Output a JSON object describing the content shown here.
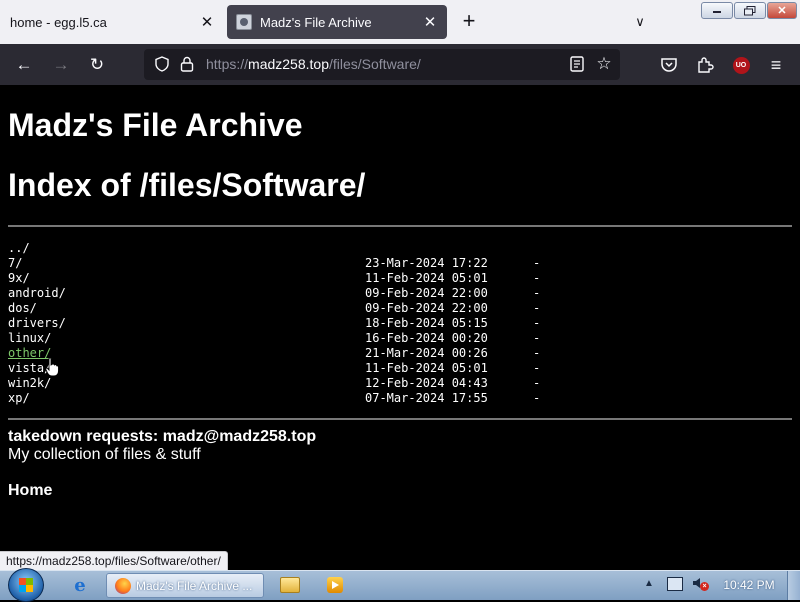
{
  "browser": {
    "tabs": [
      {
        "title": "home - egg.l5.ca",
        "active": false
      },
      {
        "title": "Madz's File Archive",
        "active": true
      }
    ],
    "url_prefix": "https://",
    "url_host": "madz258.top",
    "url_path": "/files/Software/",
    "icons": {
      "back": "←",
      "forward": "→",
      "reload": "↻",
      "star": "☆",
      "menu": "≡",
      "close": "✕",
      "new_tab": "+",
      "tab_list": "∨",
      "ublock_badge": "UO"
    }
  },
  "page": {
    "site_title": "Madz's File Archive",
    "index_title": "Index of /files/Software/",
    "parent_link": "../",
    "entries": [
      {
        "name": "7/",
        "date": "23-Mar-2024 17:22",
        "size": "-"
      },
      {
        "name": "9x/",
        "date": "11-Feb-2024 05:01",
        "size": "-"
      },
      {
        "name": "android/",
        "date": "09-Feb-2024 22:00",
        "size": "-"
      },
      {
        "name": "dos/",
        "date": "09-Feb-2024 22:00",
        "size": "-"
      },
      {
        "name": "drivers/",
        "date": "18-Feb-2024 05:15",
        "size": "-"
      },
      {
        "name": "linux/",
        "date": "16-Feb-2024 00:20",
        "size": "-"
      },
      {
        "name": "other/",
        "date": "21-Mar-2024 00:26",
        "size": "-"
      },
      {
        "name": "vista/",
        "date": "11-Feb-2024 05:01",
        "size": "-"
      },
      {
        "name": "win2k/",
        "date": "12-Feb-2024 04:43",
        "size": "-"
      },
      {
        "name": "xp/",
        "date": "07-Mar-2024 17:55",
        "size": "-"
      }
    ],
    "takedown": "takedown requests: madz@madz258.top",
    "tagline": "My collection of files & stuff",
    "home_link": "Home",
    "status_url": "https://madz258.top/files/Software/other/"
  },
  "taskbar": {
    "firefox_task_title": "Madz's File Archive ...",
    "clock": "10:42 PM",
    "tray_arrow": "▲"
  },
  "colors": {
    "visited_link": "#7ec86a",
    "ublock_red": "#b0141a",
    "toolbar": "#2b2a33"
  }
}
